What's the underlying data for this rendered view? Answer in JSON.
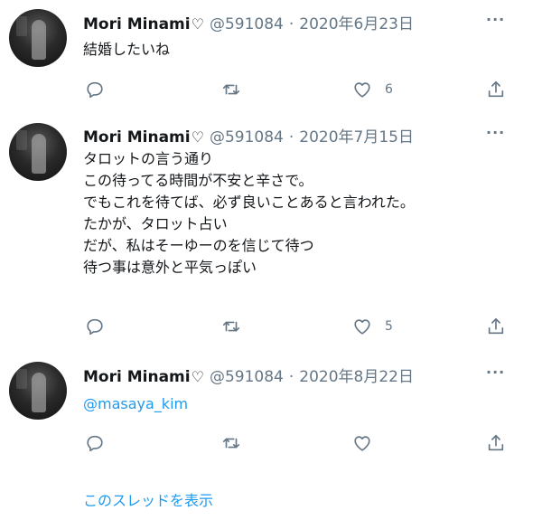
{
  "tweets": [
    {
      "name": "Mori Minami",
      "name_suffix": "♡",
      "handle": "@591084",
      "date": "2020年6月23日",
      "lines": [
        "結婚したいね"
      ],
      "likes": "6"
    },
    {
      "name": "Mori Minami",
      "name_suffix": "♡",
      "handle": "@591084",
      "date": "2020年7月15日",
      "lines": [
        "タロットの言う通り",
        "この待ってる時間が不安と辛さで。",
        "でもこれを待てば、必ず良いことあると言われた。",
        "たかが、タロット占い",
        "だが、私はそーゆーのを信じて待つ",
        "待つ事は意外と平気っぽい"
      ],
      "likes": "5"
    },
    {
      "name": "Mori Minami",
      "name_suffix": "♡",
      "handle": "@591084",
      "date": "2020年8月22日",
      "mention": "@masaya_kim",
      "likes": ""
    }
  ],
  "separator": "·",
  "more_label": "···",
  "show_thread": "このスレッドを表示",
  "icons": {
    "reply": "reply-icon",
    "retweet": "retweet-icon",
    "like": "heart-icon",
    "share": "share-icon",
    "more": "more-icon"
  },
  "colors": {
    "link": "#1d9bf0",
    "muted": "#657786",
    "text": "#14171a"
  }
}
